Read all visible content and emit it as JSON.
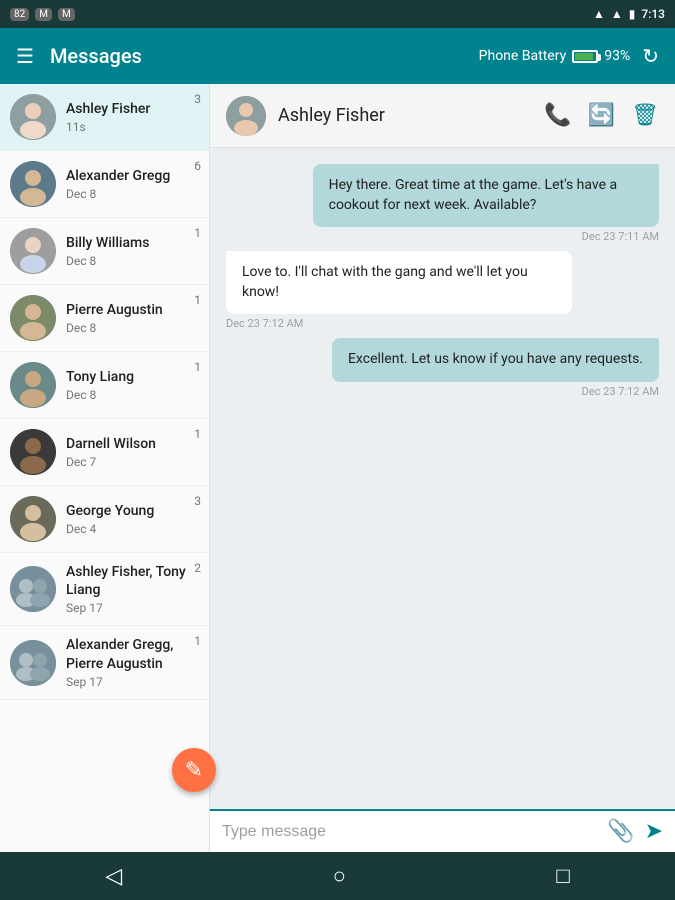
{
  "statusBar": {
    "badges": [
      "82",
      "M",
      "M"
    ],
    "time": "7:13",
    "battery_pct": "93%"
  },
  "topBar": {
    "title": "Messages",
    "battery_label": "Phone Battery",
    "battery_pct": "93%"
  },
  "sidebar": {
    "conversations": [
      {
        "id": "ashley-fisher",
        "name": "Ashley Fisher",
        "date": "11s",
        "badge": "3",
        "active": true,
        "avatar_type": "face",
        "avatar_color": "#8d9fa0"
      },
      {
        "id": "alexander-gregg",
        "name": "Alexander Gregg",
        "date": "Dec 8",
        "badge": "6",
        "active": false,
        "avatar_type": "face",
        "avatar_color": "#5d7a8a"
      },
      {
        "id": "billy-williams",
        "name": "Billy Williams",
        "date": "Dec 8",
        "badge": "1",
        "active": false,
        "avatar_type": "face",
        "avatar_color": "#9e9e9e"
      },
      {
        "id": "pierre-augustin",
        "name": "Pierre Augustin",
        "date": "Dec 8",
        "badge": "1",
        "active": false,
        "avatar_type": "face",
        "avatar_color": "#7d8a6a"
      },
      {
        "id": "tony-liang",
        "name": "Tony Liang",
        "date": "Dec 8",
        "badge": "1",
        "active": false,
        "avatar_type": "face",
        "avatar_color": "#6a8a8a"
      },
      {
        "id": "darnell-wilson",
        "name": "Darnell Wilson",
        "date": "Dec 7",
        "badge": "1",
        "active": false,
        "avatar_type": "face",
        "avatar_color": "#3a3a3a"
      },
      {
        "id": "george-young",
        "name": "George Young",
        "date": "Dec 4",
        "badge": "3",
        "active": false,
        "avatar_type": "face",
        "avatar_color": "#6a6a5a"
      },
      {
        "id": "ashley-tony",
        "name": "Ashley Fisher, Tony Liang",
        "date": "Sep 17",
        "badge": "2",
        "active": false,
        "avatar_type": "group",
        "avatar_color": "#78909c"
      },
      {
        "id": "alexander-pierre",
        "name": "Alexander Gregg, Pierre Augustin",
        "date": "Sep 17",
        "badge": "1",
        "active": false,
        "avatar_type": "group",
        "avatar_color": "#78909c"
      }
    ]
  },
  "chat": {
    "contact_name": "Ashley Fisher",
    "messages": [
      {
        "id": "msg1",
        "text": "Hey there. Great time at the game. Let's have a cookout for next week. Available?",
        "type": "sent",
        "time": "Dec 23 7:11 AM"
      },
      {
        "id": "msg2",
        "text": "Love to.  I'll chat with the gang and we'll let you know!",
        "type": "received",
        "time": "Dec 23 7:12 AM"
      },
      {
        "id": "msg3",
        "text": "Excellent. Let us know if you have any requests.",
        "type": "sent",
        "time": "Dec 23 7:12 AM"
      }
    ],
    "input_placeholder": "Type message"
  },
  "bottomNav": {
    "back_icon": "◁",
    "home_icon": "○",
    "square_icon": "□"
  },
  "fab": {
    "icon": "✎"
  }
}
